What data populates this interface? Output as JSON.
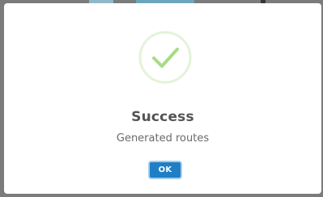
{
  "dialog": {
    "icon": "success-check-icon",
    "title": "Success",
    "text": "Generated routes",
    "confirm_label": "OK"
  },
  "colors": {
    "success": "#a5dc86",
    "success_ring": "#e3f3d9",
    "button": "#1e7fc6",
    "title": "#545454"
  }
}
